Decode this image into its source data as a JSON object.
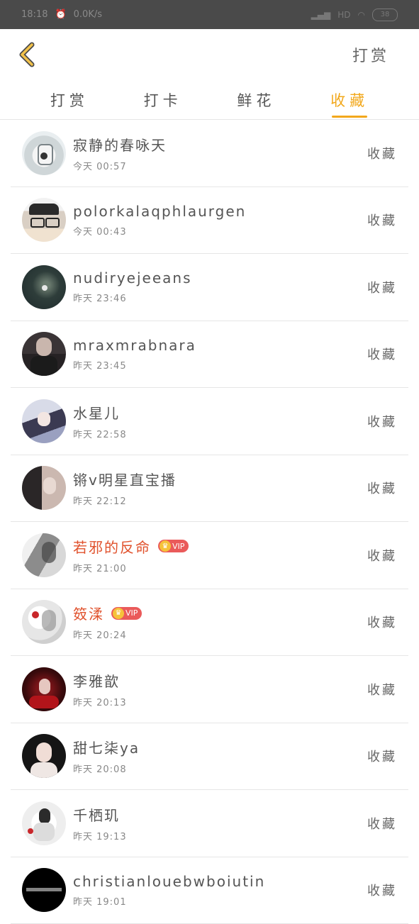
{
  "status_bar": {
    "time": "18:18",
    "speed": "0.0K/s",
    "signal": "HD",
    "battery": "38"
  },
  "header": {
    "right_button": "打赏"
  },
  "tabs": [
    {
      "label": "打赏",
      "active": false
    },
    {
      "label": "打卡",
      "active": false
    },
    {
      "label": "鲜花",
      "active": false
    },
    {
      "label": "收藏",
      "active": true
    }
  ],
  "list": [
    {
      "name": "寂静的春咏天",
      "time": "今天  00:57",
      "action": "收藏",
      "vip": false
    },
    {
      "name": "polorkalaqphlaurgen",
      "time": "今天  00:43",
      "action": "收藏",
      "vip": false
    },
    {
      "name": "nudiryejeeans",
      "time": "昨天  23:46",
      "action": "收藏",
      "vip": false
    },
    {
      "name": "mraxmrabnara",
      "time": "昨天  23:45",
      "action": "收藏",
      "vip": false
    },
    {
      "name": "水星儿",
      "time": "昨天  22:58",
      "action": "收藏",
      "vip": false
    },
    {
      "name": "锵v明星直宝播",
      "time": "昨天  22:12",
      "action": "收藏",
      "vip": false
    },
    {
      "name": "若邪的反命",
      "time": "昨天  21:00",
      "action": "收藏",
      "vip": true,
      "badge": "VIP"
    },
    {
      "name": "笯渘",
      "time": "昨天  20:24",
      "action": "收藏",
      "vip": true,
      "badge": "VIP"
    },
    {
      "name": "李雅歆",
      "time": "昨天  20:13",
      "action": "收藏",
      "vip": false
    },
    {
      "name": "甜七柒ya",
      "time": "昨天  20:08",
      "action": "收藏",
      "vip": false
    },
    {
      "name": "千栖玑",
      "time": "昨天  19:13",
      "action": "收藏",
      "vip": false
    },
    {
      "name": "christianlouebwboiutin",
      "time": "昨天  19:01",
      "action": "收藏",
      "vip": false
    }
  ],
  "colors": {
    "accent": "#f2a81c",
    "vip_name": "#e0512c"
  }
}
